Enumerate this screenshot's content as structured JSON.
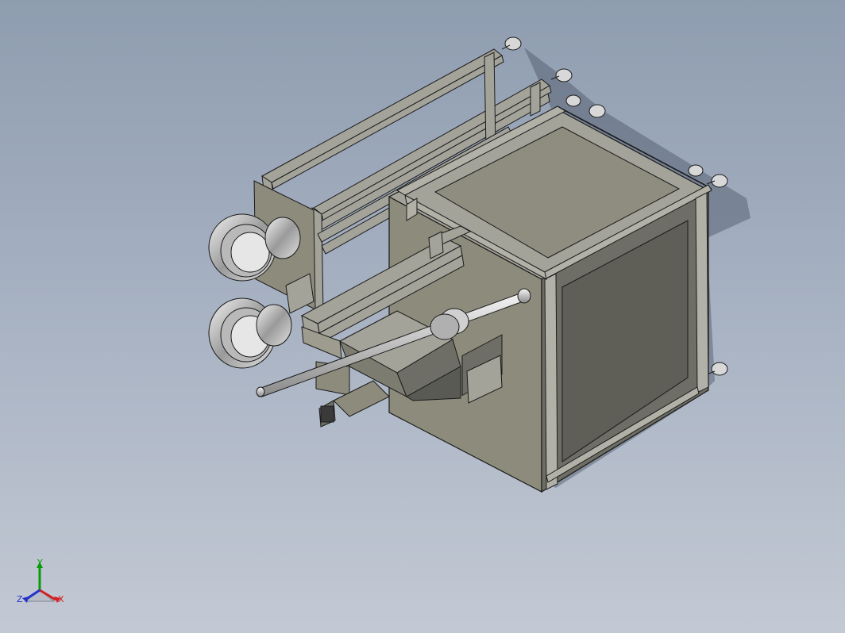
{
  "viewport": {
    "background_top": "#8f9db0",
    "background_bottom": "#c3c9d4",
    "content": "3d-cad-assembly"
  },
  "model": {
    "colors": {
      "panel_side": "#8c8b7c",
      "panel_front": "#6e6e66",
      "panel_top": "#9d9c8e",
      "frame": "#a4a39a",
      "edge": "#1a1a1a",
      "metal": "#c8c8c8",
      "shadow": "#4a5466"
    }
  },
  "triad": {
    "x_label": "X",
    "y_label": "Y",
    "z_label": "Z",
    "x_color": "#d42020",
    "y_color": "#0a9a0a",
    "z_color": "#2233cc"
  }
}
